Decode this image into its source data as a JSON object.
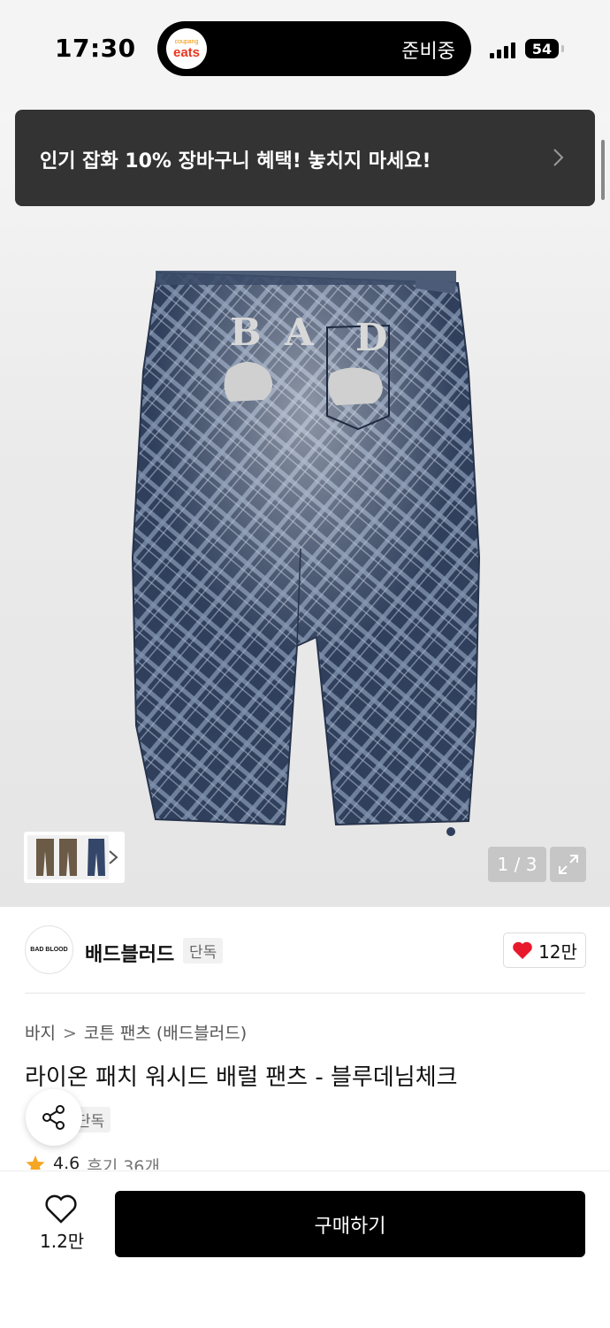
{
  "status_bar": {
    "time": "17:30",
    "app_logo_small": "coupang",
    "app_logo_big": "eats",
    "island_text": "준비중",
    "battery": "54"
  },
  "promo": {
    "text": "인기 잡화 10% 장바구니 혜택! 놓치지 마세요!"
  },
  "gallery": {
    "page_indicator": "1 / 3",
    "graphic_letters": [
      "B",
      "A",
      "D"
    ]
  },
  "brand": {
    "logo_text": "BAD BLOOD",
    "name": "배드블러드",
    "tag": "단독",
    "like_count": "12만"
  },
  "product": {
    "breadcrumb": [
      "바지",
      "코튼 팬츠 (배드블러드)"
    ],
    "title": "라이온 패치 워시드 배럴 팬츠 - 블루데님체크",
    "exclusive_tag": "단독",
    "rating": "4.6",
    "review_label": "후기 36개"
  },
  "bottom_bar": {
    "wish_count": "1.2만",
    "buy_label": "구매하기"
  },
  "colors": {
    "promo_bg": "#333333",
    "heart": "#e8192c",
    "star": "#f5a623",
    "buy_bg": "#000000"
  }
}
